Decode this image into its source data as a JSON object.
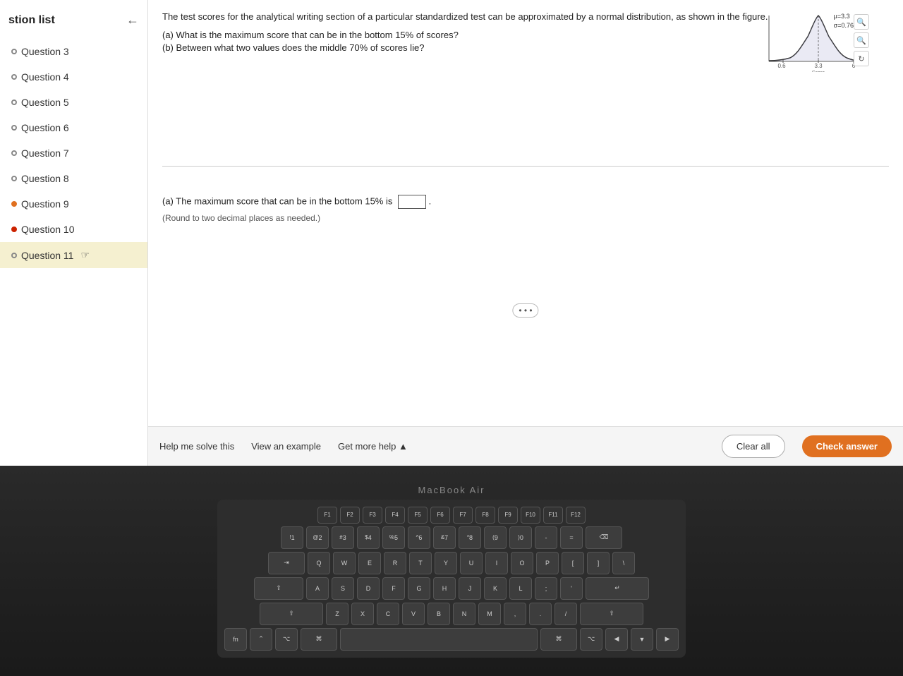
{
  "sidebar": {
    "title": "stion list",
    "collapse_icon": "←",
    "items": [
      {
        "id": "q3",
        "label": "Question 3",
        "state": "none"
      },
      {
        "id": "q4",
        "label": "Question 4",
        "state": "none"
      },
      {
        "id": "q5",
        "label": "Question 5",
        "state": "none"
      },
      {
        "id": "q6",
        "label": "Question 6",
        "state": "none"
      },
      {
        "id": "q7",
        "label": "Question 7",
        "state": "none"
      },
      {
        "id": "q8",
        "label": "Question 8",
        "state": "none"
      },
      {
        "id": "q9",
        "label": "Question 9",
        "state": "dot-orange"
      },
      {
        "id": "q10",
        "label": "Question 10",
        "state": "dot-red"
      },
      {
        "id": "q11",
        "label": "Question 11",
        "state": "active"
      }
    ]
  },
  "question": {
    "intro": "The test scores for the analytical writing section of a particular standardized test can be approximated by a normal distribution, as shown in the figure.",
    "part_a_prompt": "(a) What is the maximum score that can be in the bottom 15% of scores?",
    "part_b_prompt": "(b) Between what two values does the middle 70% of scores lie?",
    "chart": {
      "mu": "μ=3.3",
      "sigma": "σ=0.76",
      "x_labels": [
        "0.6",
        "3.3",
        "6"
      ],
      "x_axis_label": "Score"
    },
    "answer_a_label": "(a) The maximum score that can be in the bottom 15% is",
    "answer_a_note": "(Round to two decimal places as needed.)"
  },
  "toolbar": {
    "help_me_label": "Help me solve this",
    "view_example_label": "View an example",
    "get_more_help_label": "Get more help ▲",
    "clear_all_label": "Clear all",
    "check_answer_label": "Check answer"
  },
  "macbook": {
    "label": "MacBook Air"
  },
  "keyboard": {
    "fn_row": [
      "F1",
      "F2",
      "F3",
      "F4",
      "F5",
      "F6",
      "F7",
      "F8",
      "F9",
      "F10",
      "F11",
      "F12"
    ],
    "row1": [
      "!1",
      "@2",
      "#3",
      "$4",
      "%5",
      "^6",
      "&7",
      "*8",
      "(9",
      ")0",
      "-",
      "=",
      "⌫"
    ],
    "row2": [
      "⇥",
      "Q",
      "W",
      "E",
      "R",
      "T",
      "Y",
      "U",
      "I",
      "O",
      "P",
      "[",
      "]",
      "\\"
    ],
    "row3": [
      "⇪",
      "A",
      "S",
      "D",
      "F",
      "G",
      "H",
      "J",
      "K",
      "L",
      ";",
      "'",
      "↵"
    ],
    "row4": [
      "⇧",
      "Z",
      "X",
      "C",
      "V",
      "B",
      "N",
      "M",
      ",",
      ".",
      "/",
      "⇧"
    ],
    "row5": [
      "fn",
      "⌃",
      "⌥",
      "⌘",
      "",
      "⌘",
      "⌥",
      "◀",
      "▼",
      "▶"
    ]
  }
}
